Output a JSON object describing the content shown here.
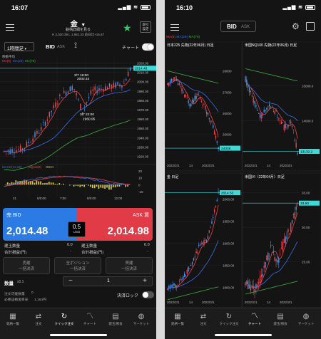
{
  "left_screen": {
    "status_time": "16:07",
    "title": "金",
    "detail_link": "銘柄詳細を見る",
    "badge": "取引設定",
    "change_text": "H 2,020.39 L 1,981.33  前日比+16.57",
    "timeframe": "1時間足",
    "bid_label": "BID",
    "ask_label": "ASK",
    "chart_toggle_label": "チャート",
    "indicator_label": "移動平均",
    "ma_labels": [
      "MA(5)",
      "MA(25)",
      "MA(75)"
    ],
    "current_price_label": "2014.48",
    "price_ticks": [
      "2020.00",
      "2010.00",
      "2000.00",
      "1990.00",
      "1980.00",
      "1970.00",
      "1960.00",
      "1950.00",
      "1940.00",
      "1930.00",
      "1920.00"
    ],
    "annotations": [
      {
        "label": "3/7 19:00",
        "value": "2002.44"
      },
      {
        "label": "3/7 22:00",
        "value": "1960.95"
      }
    ],
    "macd_label": "MACD(12,26)",
    "signal_label": "Signal(9)",
    "osci_label": "OSCI",
    "macd_ticks": [
      "20",
      "10",
      "0",
      "-10"
    ],
    "time_ticks": [
      "21",
      "5/0:00",
      "7:00",
      "8/0:00",
      "12:00"
    ],
    "sell_label": "売 BID",
    "buy_label": "ASK 買",
    "bid_price": "2,014.48",
    "ask_price": "2,014.98",
    "spread_value": "0.5",
    "spread_unit": "USD",
    "position_rows": [
      {
        "label": "建玉数量",
        "value": "0.0",
        "label2": "建玉数量",
        "value2": "0.0"
      },
      {
        "label": "合計損益(円)",
        "value": "-",
        "label2": "合計損益(円)",
        "value2": "-"
      }
    ],
    "close_buttons": [
      {
        "line1": "売建",
        "line2": "一括決済"
      },
      {
        "line1": "全ポジション",
        "line2": "一括決済"
      },
      {
        "line1": "買建",
        "line2": "一括決済"
      }
    ],
    "quantity_label": "数量",
    "quantity_unit": "x0.1",
    "quantity_value": "1",
    "minus": "−",
    "plus": "+",
    "settle_lock_label": "決済ロック",
    "order_limit_label": "注文可能数量",
    "order_limit_value": "0",
    "margin_label": "必要証拠金目安",
    "margin_value": "1,164円",
    "tabs": [
      "銘柄一覧",
      "注文",
      "クイック注文",
      "チャート",
      "建玉/照会",
      "マーケット"
    ],
    "active_tab": 2
  },
  "right_screen": {
    "status_time": "16:10",
    "bid_label": "BID",
    "ask_label": "ASK",
    "ma_labels": [
      "MA(5)",
      "MA(25)",
      "MA(75)"
    ],
    "panels": [
      {
        "title": "日本225 先物(22年06月)  日足",
        "ticks": [
          "28000",
          "27000",
          "26000",
          "25000"
        ],
        "price_label": "24338",
        "dates": [
          "2022/2/1",
          "14",
          "2022/3/1"
        ]
      },
      {
        "title": "米国NQ100 先物(22年06月)  日足",
        "ticks": [
          "15000.0",
          "14000.0"
        ],
        "price_label": "13132.2",
        "dates": [
          "2022/2/1",
          "14",
          "2022/3/1"
        ]
      },
      {
        "title": "金  日足",
        "ticks": [
          "2000.00",
          "1950.00",
          "1900.00",
          "1850.00",
          "1800.00"
        ],
        "price_label": "2014.53",
        "dates": [
          "2022/2/1",
          "14",
          "2022/3/1"
        ]
      },
      {
        "title": "米国VI（22年04月）日足",
        "ticks": [
          "35.00",
          "30.00",
          "25.00"
        ],
        "price_label": "33.50",
        "dates": [
          "2022/2/1",
          "14",
          "2022/3/1"
        ]
      }
    ],
    "tabs": [
      "銘柄一覧",
      "注文",
      "クイック注文",
      "チャート",
      "建玉/照会",
      "マーケット"
    ],
    "active_tab": 3
  },
  "colors": {
    "bull": "#e8474c",
    "bear": "#4a90e2",
    "accent": "#3ddad7",
    "ma5": "#e8474c",
    "ma25": "#3b6ee8",
    "ma75": "#3fae3f",
    "sell": "#2c7be5",
    "buy": "#e03b46"
  }
}
